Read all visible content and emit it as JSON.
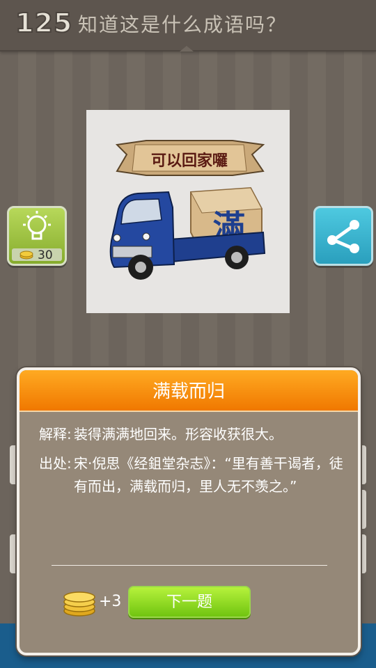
{
  "header": {
    "level": "125",
    "question": "知道这是什么成语吗？"
  },
  "puzzle": {
    "banner_text": "可以回家囉",
    "cargo_text": "滿"
  },
  "hint": {
    "cost": "30"
  },
  "dialog": {
    "title": "满载而归",
    "explain_label": "解释:",
    "explain_text": "装得满满地回来。形容收获很大。",
    "source_label": "出处:",
    "source_text": "宋·倪思《经鉏堂杂志》：“里有善干谒者，徒有而出，满载而归，里人无不羡之。”",
    "reward": "+3",
    "next_label": "下一题"
  },
  "colors": {
    "accent_orange": "#f08a00",
    "next_green": "#8ad21c",
    "hint_green": "#9cc241",
    "share_blue": "#35b2d0"
  },
  "icons": {
    "hint": "lightbulb-icon",
    "share": "share-icon",
    "coins": "coin-stack-icon"
  }
}
